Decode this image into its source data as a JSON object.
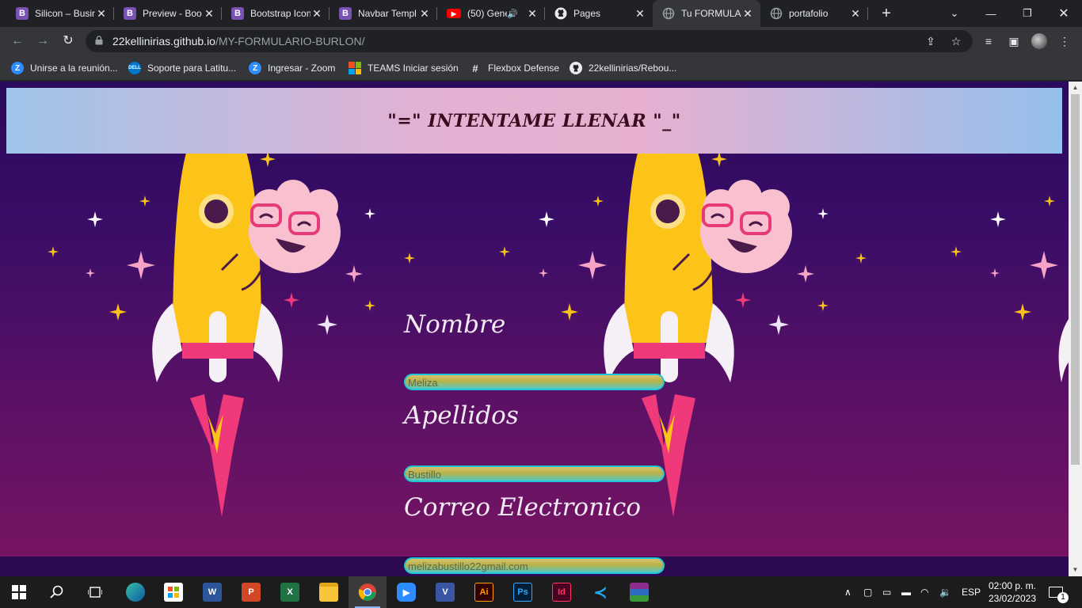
{
  "browser": {
    "tabs": [
      {
        "title": "Silicon – Busin",
        "icon": "bootstrap-icon"
      },
      {
        "title": "Preview - Boo",
        "icon": "bootstrap-icon"
      },
      {
        "title": "Bootstrap Icon",
        "icon": "bootstrap-icon"
      },
      {
        "title": "Navbar Templ",
        "icon": "bootstrap-icon"
      },
      {
        "title": "(50) Gene",
        "icon": "youtube-icon"
      },
      {
        "title": "Pages",
        "icon": "github-icon"
      },
      {
        "title": "Tu FORMULA",
        "icon": "globe-icon"
      },
      {
        "title": "portafolio",
        "icon": "globe-icon"
      }
    ],
    "url_host": "22kellinirias.github.io",
    "url_path": "/MY-FORMULARIO-BURLON/",
    "bookmarks": [
      {
        "label": "Unirse a la reunión...",
        "icon": "zoom-icon"
      },
      {
        "label": "Soporte para Latitu...",
        "icon": "dell-icon"
      },
      {
        "label": "Ingresar - Zoom",
        "icon": "zoom-icon"
      },
      {
        "label": "TEAMS Iniciar sesión",
        "icon": "microsoft-icon"
      },
      {
        "label": "Flexbox Defense",
        "icon": "hash-icon"
      },
      {
        "label": "22kellinirias/Rebou...",
        "icon": "github-icon"
      }
    ]
  },
  "page": {
    "heading": "\"=\" INTENTAME LLENAR \"_\"",
    "fields": [
      {
        "label": "Nombre",
        "value": "Meliza"
      },
      {
        "label": "Apellidos",
        "value": "Bustillo"
      },
      {
        "label": "Correo Electronico",
        "value": "melizabustillo22gmail.com"
      }
    ]
  },
  "taskbar": {
    "apps": [
      "start-icon",
      "search-icon",
      "task-view-icon",
      "edge-icon",
      "store-icon",
      "word-icon",
      "powerpoint-icon",
      "excel-icon",
      "file-explorer-icon",
      "chrome-icon",
      "zoom-icon",
      "visio-icon",
      "illustrator-icon",
      "photoshop-icon",
      "indesign-icon",
      "vscode-icon",
      "winrar-icon"
    ],
    "language": "ESP",
    "time": "02:00 p. m.",
    "date": "23/02/2023",
    "notification_count": "1"
  },
  "colors": {
    "accent_tab_bg": "#35363a",
    "banner_text": "#3b0a1f",
    "input_border": "#1ec6d6"
  }
}
